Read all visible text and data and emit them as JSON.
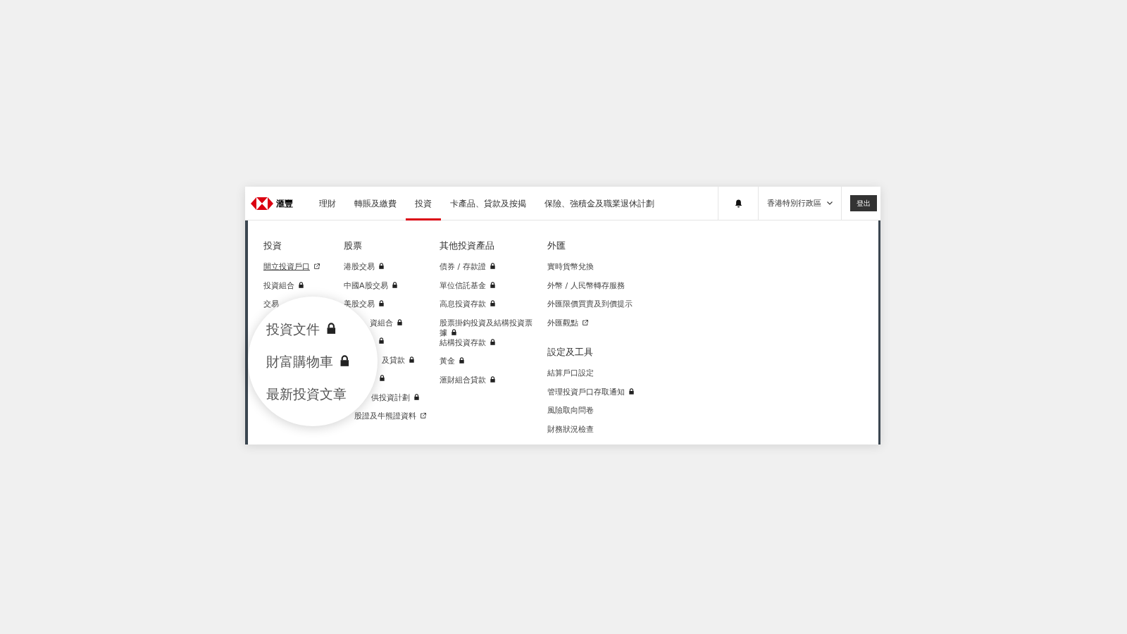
{
  "logo": {
    "text": "滙豐"
  },
  "nav": [
    {
      "label": "理財",
      "selected": false
    },
    {
      "label": "轉賬及繳費",
      "selected": false
    },
    {
      "label": "投資",
      "selected": true
    },
    {
      "label": "卡產品、貸款及按揭",
      "selected": false
    },
    {
      "label": "保險、強積金及職業退休計劃",
      "selected": false
    }
  ],
  "region": {
    "label": "香港特別行政區"
  },
  "logout": {
    "label": "登出"
  },
  "menu": {
    "columns": [
      {
        "sections": [
          {
            "heading": "投資",
            "items": [
              {
                "label": "開立投資戶口",
                "kind": "external",
                "underlined": true
              },
              {
                "label": "投資組合",
                "kind": "lock",
                "underlined": false
              },
              {
                "label": "交易",
                "kind": "plain",
                "underlined": false
              }
            ]
          }
        ]
      },
      {
        "sections": [
          {
            "heading": "股票",
            "items": [
              {
                "label": "港股交易",
                "kind": "lock",
                "underlined": false
              },
              {
                "label": "中國A股交易",
                "kind": "lock",
                "underlined": false
              },
              {
                "label": "美股交易",
                "kind": "lock",
                "underlined": false,
                "clipped": false
              },
              {
                "label": "資組合",
                "kind": "lock",
                "underlined": false,
                "clipped": true
              },
              {
                "kind": "lock",
                "clipped": true
              },
              {
                "label": "及貸款",
                "kind": "lock",
                "underlined": false,
                "clipped": true
              },
              {
                "kind": "lock",
                "clipped": true
              },
              {
                "label": "供投資計劃",
                "kind": "lock",
                "underlined": false,
                "clipped": true
              },
              {
                "label": "股證及牛熊證資料",
                "kind": "external",
                "underlined": false,
                "clipped": true
              }
            ]
          }
        ]
      },
      {
        "sections": [
          {
            "heading": "其他投資產品",
            "items": [
              {
                "label": "債券 / 存款證",
                "kind": "lock",
                "underlined": false
              },
              {
                "label": "單位信託基金",
                "kind": "lock",
                "underlined": false
              },
              {
                "label": "高息投資存款",
                "kind": "lock",
                "underlined": false
              },
              {
                "label": "股票掛鈎投資及結構投資票據",
                "kind": "lock",
                "underlined": false
              },
              {
                "label": "結構投資存款",
                "kind": "lock",
                "underlined": false
              },
              {
                "label": "黃金",
                "kind": "lock",
                "underlined": false
              },
              {
                "label": "滙財組合貸款",
                "kind": "lock",
                "underlined": false
              }
            ]
          }
        ]
      },
      {
        "sections": [
          {
            "heading": "外匯",
            "items": [
              {
                "label": "實時貨幣兌換",
                "kind": "plain",
                "underlined": false
              },
              {
                "label": "外幣 / 人民幣轉存服務",
                "kind": "plain",
                "underlined": false
              },
              {
                "label": "外匯限價買賣及到價提示",
                "kind": "plain",
                "underlined": false
              },
              {
                "label": "外匯觀點",
                "kind": "external",
                "underlined": false
              }
            ]
          },
          {
            "heading": "設定及工具",
            "items": [
              {
                "label": "結算戶口設定",
                "kind": "plain",
                "underlined": false
              },
              {
                "label": "管理投資戶口存取通知",
                "kind": "lock",
                "underlined": false
              },
              {
                "label": "風險取向問卷",
                "kind": "plain",
                "underlined": false
              },
              {
                "label": "財務狀況檢查",
                "kind": "plain",
                "underlined": false
              }
            ]
          }
        ]
      }
    ]
  },
  "magnifier": {
    "items": [
      {
        "label": "投資文件",
        "kind": "lock"
      },
      {
        "label": "財富購物車",
        "kind": "lock"
      },
      {
        "label": "最新投資文章",
        "kind": "plain"
      }
    ]
  }
}
